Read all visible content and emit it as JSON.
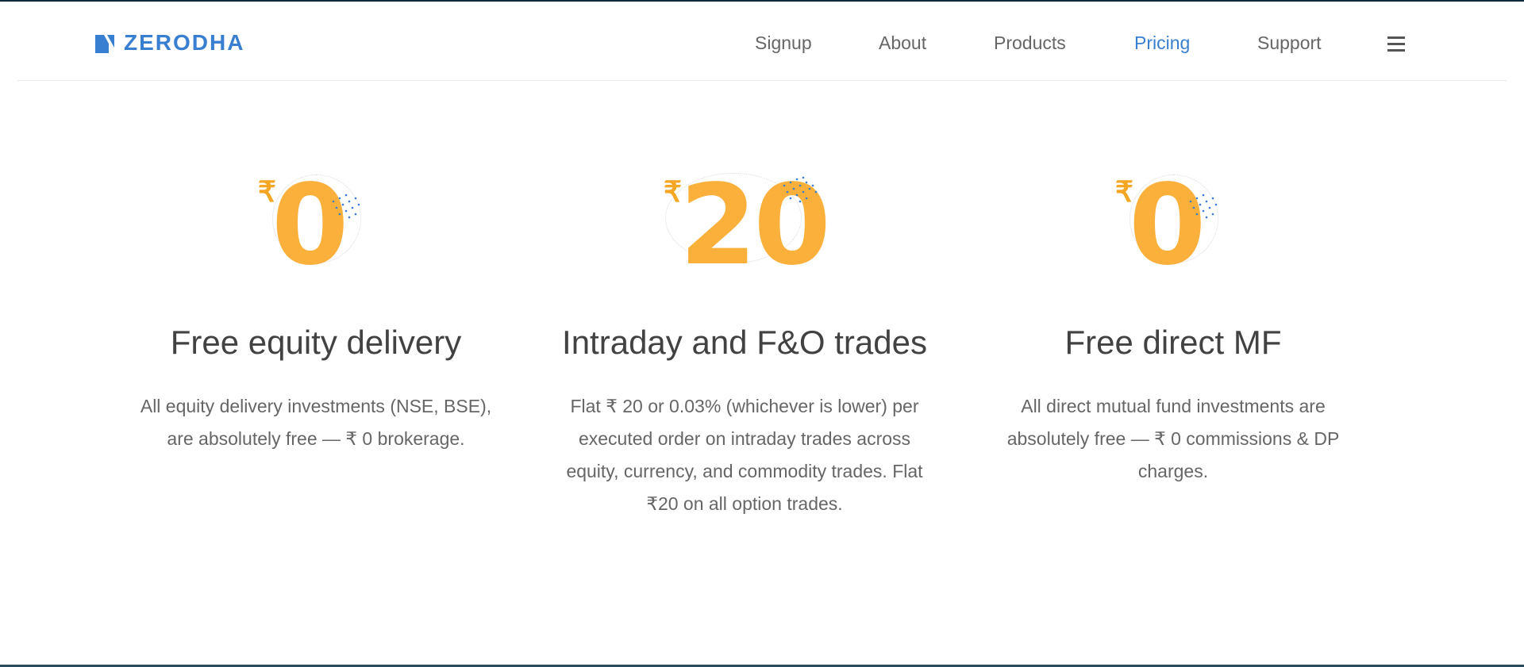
{
  "brand": {
    "name": "ZERODHA",
    "color": "#387ed1"
  },
  "nav": {
    "links": [
      {
        "label": "Signup",
        "active": false
      },
      {
        "label": "About",
        "active": false
      },
      {
        "label": "Products",
        "active": false
      },
      {
        "label": "Pricing",
        "active": true
      },
      {
        "label": "Support",
        "active": false
      }
    ],
    "menu_icon": "hamburger-icon"
  },
  "colors": {
    "accent": "#387ed1",
    "price": "#fbb03b",
    "text": "#424242",
    "muted": "#666666"
  },
  "features": [
    {
      "currency": "₹",
      "amount": "0",
      "title": "Free equity delivery",
      "description": "All equity delivery investments (NSE, BSE), are absolutely free — ₹ 0 brokerage."
    },
    {
      "currency": "₹",
      "amount": "20",
      "title": "Intraday and F&O trades",
      "description": "Flat ₹ 20 or 0.03% (whichever is lower) per executed order on intraday trades across equity, currency, and commodity trades. Flat ₹20 on all option trades."
    },
    {
      "currency": "₹",
      "amount": "0",
      "title": "Free direct MF",
      "description": "All direct mutual fund investments are absolutely free — ₹ 0 commissions & DP charges."
    }
  ]
}
